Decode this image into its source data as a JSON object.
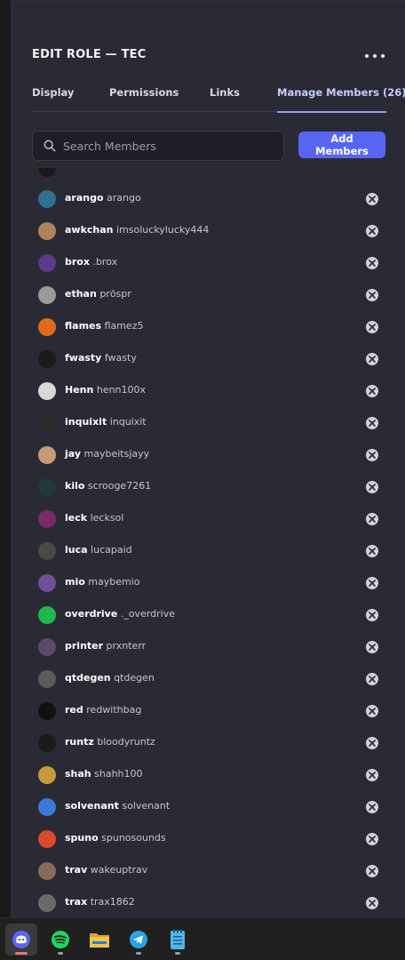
{
  "header": {
    "title": "EDIT ROLE — TEC"
  },
  "tabs": [
    {
      "label": "Display"
    },
    {
      "label": "Permissions"
    },
    {
      "label": "Links"
    },
    {
      "label": "Manage Members (26)"
    }
  ],
  "search": {
    "placeholder": "Search Members",
    "value": ""
  },
  "add_members_label": "Add Members",
  "members": [
    {
      "display": "arango",
      "username": "arango",
      "avatar_color": "#2f6f8f"
    },
    {
      "display": "awkchan",
      "username": "imsoluckylucky444",
      "avatar_color": "#b0845a"
    },
    {
      "display": "brox",
      "username": ".brox",
      "avatar_color": "#5a3a8a"
    },
    {
      "display": "ethan",
      "username": "prōspr",
      "avatar_color": "#9a9a9a"
    },
    {
      "display": "flames",
      "username": "flamez5",
      "avatar_color": "#e06a1a"
    },
    {
      "display": "fwasty",
      "username": "fwasty",
      "avatar_color": "#1a1a1a"
    },
    {
      "display": "Henn",
      "username": "henn100x",
      "avatar_color": "#d8d8d8"
    },
    {
      "display": "inquixit",
      "username": "inquixit",
      "avatar_color": "#2a2a2a"
    },
    {
      "display": "jay",
      "username": "maybeitsjayy",
      "avatar_color": "#c89a78"
    },
    {
      "display": "kilo",
      "username": "scrooge7261",
      "avatar_color": "#203a3a"
    },
    {
      "display": "leck",
      "username": "lecksol",
      "avatar_color": "#7a2a6a"
    },
    {
      "display": "luca",
      "username": "lucapaid",
      "avatar_color": "#4a4a42"
    },
    {
      "display": "mio",
      "username": "maybemio",
      "avatar_color": "#6f4f9a"
    },
    {
      "display": "overdrive",
      "username": "._overdrive",
      "avatar_color": "#1fb84a"
    },
    {
      "display": "printer",
      "username": "prxnterr",
      "avatar_color": "#5a4a6a"
    },
    {
      "display": "qtdegen",
      "username": "qtdegen",
      "avatar_color": "#5a5a5a"
    },
    {
      "display": "red",
      "username": "redwithbag",
      "avatar_color": "#111111"
    },
    {
      "display": "runtz",
      "username": "bloodyruntz",
      "avatar_color": "#1a1a1a"
    },
    {
      "display": "shah",
      "username": "shahh100",
      "avatar_color": "#c89a3a"
    },
    {
      "display": "solvenant",
      "username": "solvenant",
      "avatar_color": "#3a7ad8"
    },
    {
      "display": "spuno",
      "username": "spunosounds",
      "avatar_color": "#d84a2a"
    },
    {
      "display": "trav",
      "username": "wakeuptrav",
      "avatar_color": "#8a6a5a"
    },
    {
      "display": "trax",
      "username": "trax1862",
      "avatar_color": "#6a6a6a"
    }
  ],
  "taskbar": [
    {
      "icon": "discord-icon",
      "color": "#5865f2",
      "active": true,
      "indicator": "#e0797a"
    },
    {
      "icon": "spotify-icon",
      "color": "#1ed760",
      "active": false,
      "indicator": "#9a9a9a"
    },
    {
      "icon": "file-explorer-icon",
      "color": "#f5c242",
      "active": false,
      "indicator": ""
    },
    {
      "icon": "telegram-icon",
      "color": "#2aa3e0",
      "active": false,
      "indicator": "#9a9a9a"
    },
    {
      "icon": "notepad-icon",
      "color": "#4fb6e8",
      "active": false,
      "indicator": "#9a9a9a"
    }
  ],
  "colors": {
    "accent": "#5865f2",
    "tab_active": "#c9cdfb",
    "panel_bg": "#2a2a35"
  }
}
